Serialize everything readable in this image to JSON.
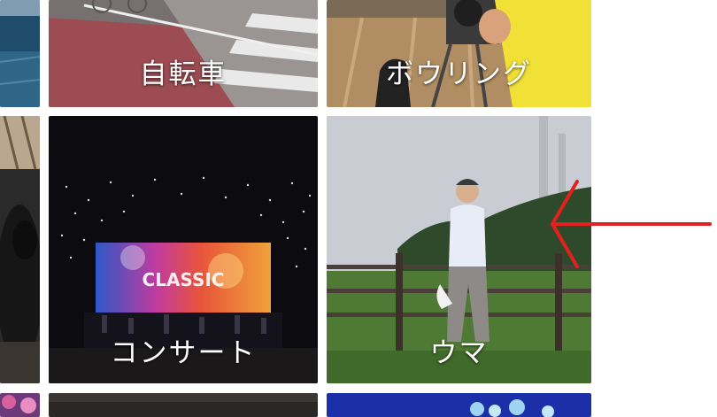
{
  "grid": {
    "tiles": [
      {
        "label": "自転車",
        "icon": "bicycle-photo"
      },
      {
        "label": "ボウリング",
        "icon": "bowling-photo"
      },
      {
        "label": "コンサート",
        "icon": "concert-photo"
      },
      {
        "label": "ウマ",
        "icon": "horse-photo"
      }
    ],
    "concert_screen_text": "CLASSIC"
  },
  "annotation": {
    "arrow_color": "#e32020",
    "arrow_direction": "left"
  },
  "colors": {
    "background": "#ffffff",
    "label_text": "#ffffff",
    "accent_arrow": "#e32020"
  }
}
